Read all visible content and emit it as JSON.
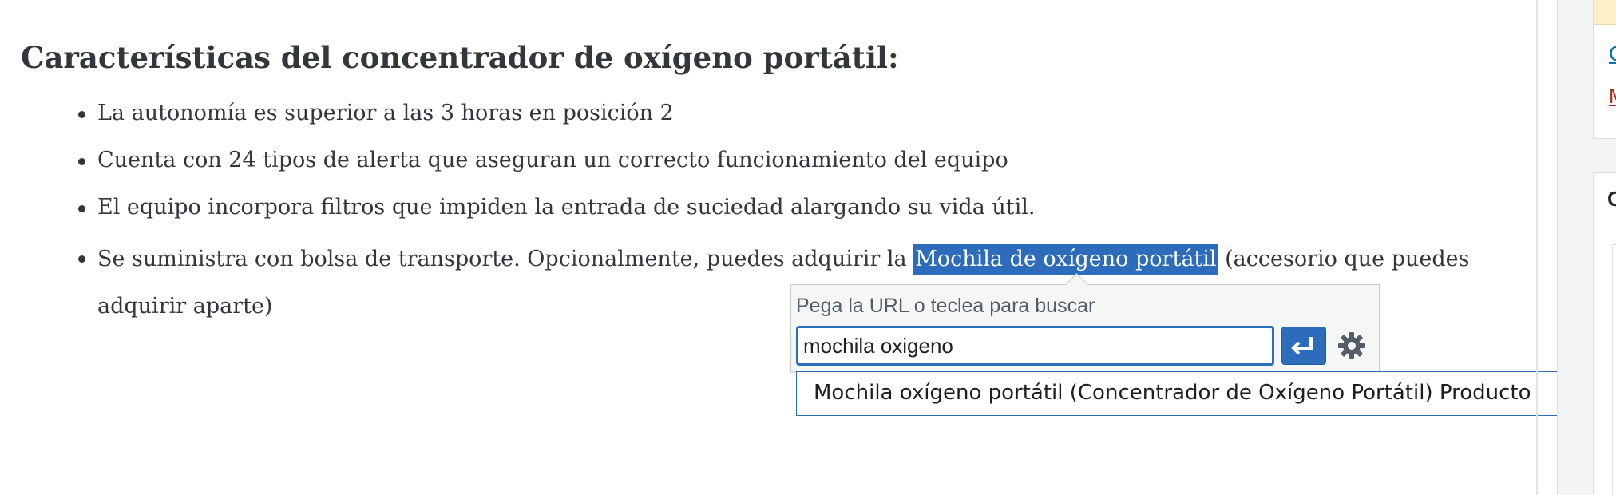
{
  "content": {
    "heading": "Características del concentrador de oxígeno portátil:",
    "bullets": [
      "La autonomía es superior a las 3 horas en posición 2",
      "Cuenta con 24 tipos de alerta que aseguran un correcto funcionamiento del equipo",
      "El equipo incorpora filtros que impiden la entrada de suciedad alargando su vida útil."
    ],
    "last_bullet": {
      "before": "Se suministra con bolsa de transporte. Opcionalmente, puedes adquirir la ",
      "link_text": "Mochila de oxígeno portátil",
      "after_line1": " (accesorio que puedes",
      "line2": "adquirir aparte)"
    }
  },
  "link_popover": {
    "label": "Pega la URL o teclea para buscar",
    "input_value": "mochila oxigeno",
    "apply_icon": "enter-arrow-icon",
    "settings_icon": "gear-icon",
    "suggestion": "Mochila oxígeno portátil (Concentrador de Oxígeno Portátil) Producto"
  },
  "sidebar": {
    "link_1": "C",
    "link_2": "M",
    "panel_title": "C"
  },
  "colors": {
    "accent": "#2d6cbb",
    "text": "#32373c",
    "notice": "#fcf0c8"
  }
}
